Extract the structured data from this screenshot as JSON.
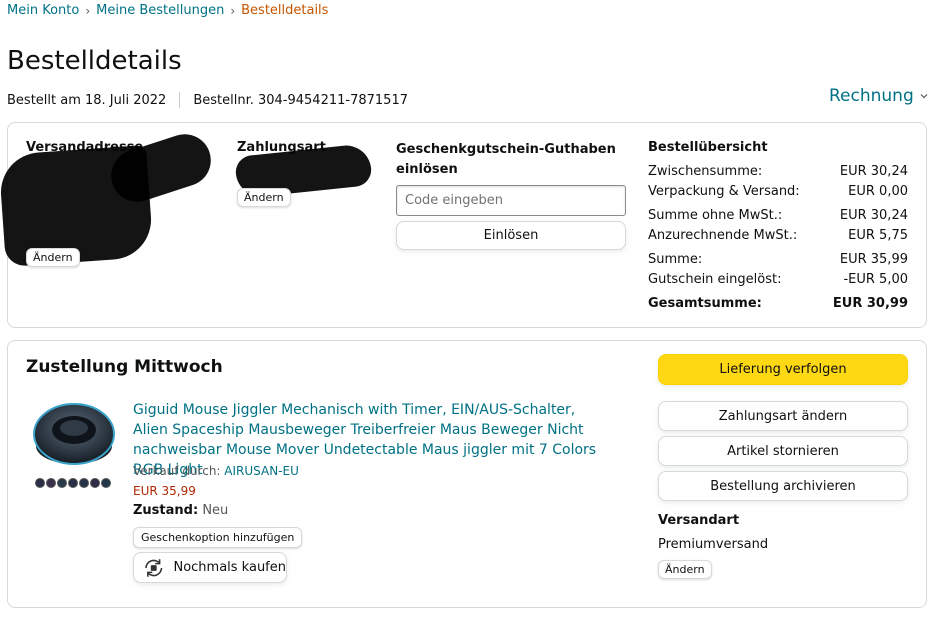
{
  "breadcrumb": {
    "items": [
      "Mein Konto",
      "Meine Bestellungen"
    ],
    "current": "Bestelldetails",
    "separator": "›"
  },
  "page": {
    "title": "Bestelldetails",
    "ordered_on": "Bestellt am 18. Juli 2022",
    "order_number": "Bestellnr. 304-9454211-7871517",
    "invoice_label": "Rechnung"
  },
  "shipping_address": {
    "title": "Versandadresse",
    "change_label": "Ändern"
  },
  "payment": {
    "title": "Zahlungsart",
    "change_label": "Ändern"
  },
  "giftcard": {
    "title": "Geschenkgutschein-Guthaben einlösen",
    "placeholder": "Code eingeben",
    "redeem_label": "Einlösen"
  },
  "summary": {
    "title": "Bestellübersicht",
    "rows": [
      {
        "label": "Zwischensumme:",
        "value": "EUR 30,24"
      },
      {
        "label": "Verpackung & Versand:",
        "value": "EUR 0,00"
      },
      {
        "label": "Summe ohne MwSt.:",
        "value": "EUR 30,24"
      },
      {
        "label": "Anzurechnende MwSt.:",
        "value": "EUR 5,75"
      },
      {
        "label": "Summe:",
        "value": "EUR 35,99"
      },
      {
        "label": "Gutschein eingelöst:",
        "value": "-EUR 5,00"
      }
    ],
    "total_label": "Gesamtsumme:",
    "total_value": "EUR 30,99"
  },
  "delivery": {
    "title": "Zustellung Mittwoch",
    "product_title": "Giguid Mouse Jiggler Mechanisch with Timer, EIN/AUS-Schalter, Alien Spaceship Mausbeweger Treiberfreier Maus Beweger Nicht nachweisbar Mouse Mover Undetectable Maus jiggler mit 7 Colors RGB Light",
    "sold_by_label": "Verkauf durch:",
    "seller": "AIRUSAN-EU",
    "price": "EUR 35,99",
    "condition_label": "Zustand:",
    "condition": "Neu",
    "gift_option_label": "Geschenkoption hinzufügen",
    "buy_again_label": "Nochmals kaufen"
  },
  "actions": {
    "track": "Lieferung verfolgen",
    "change_payment": "Zahlungsart ändern",
    "cancel_items": "Artikel stornieren",
    "archive_order": "Bestellung archivieren"
  },
  "shipping_method": {
    "title": "Versandart",
    "value": "Premiumversand",
    "change_label": "Ändern"
  },
  "colors": {
    "link": "#007185",
    "breadcrumb_current": "#c45500",
    "price": "#b12704",
    "primary_button": "#ffd814",
    "border": "#d5d9d9"
  }
}
